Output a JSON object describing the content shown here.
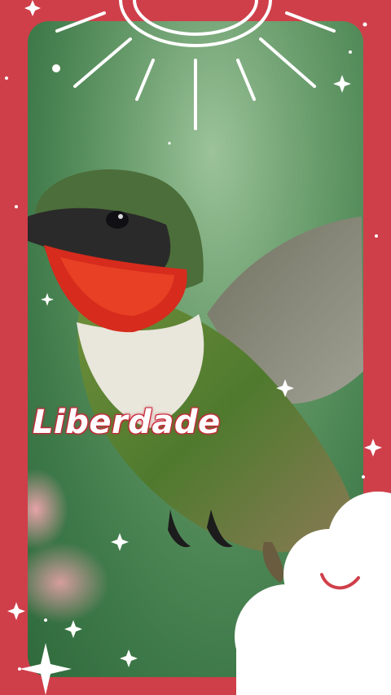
{
  "caption": {
    "text": "Liberdade"
  },
  "colors": {
    "frame": "#cf3f4a",
    "throat": "#d62b1d",
    "caption_glow": "#c8283a",
    "cloud": "#ffffff"
  },
  "decorations": [
    "sun-icon",
    "sparkle-icon",
    "cloud-icon"
  ],
  "photo": {
    "subject": "hummingbird"
  }
}
